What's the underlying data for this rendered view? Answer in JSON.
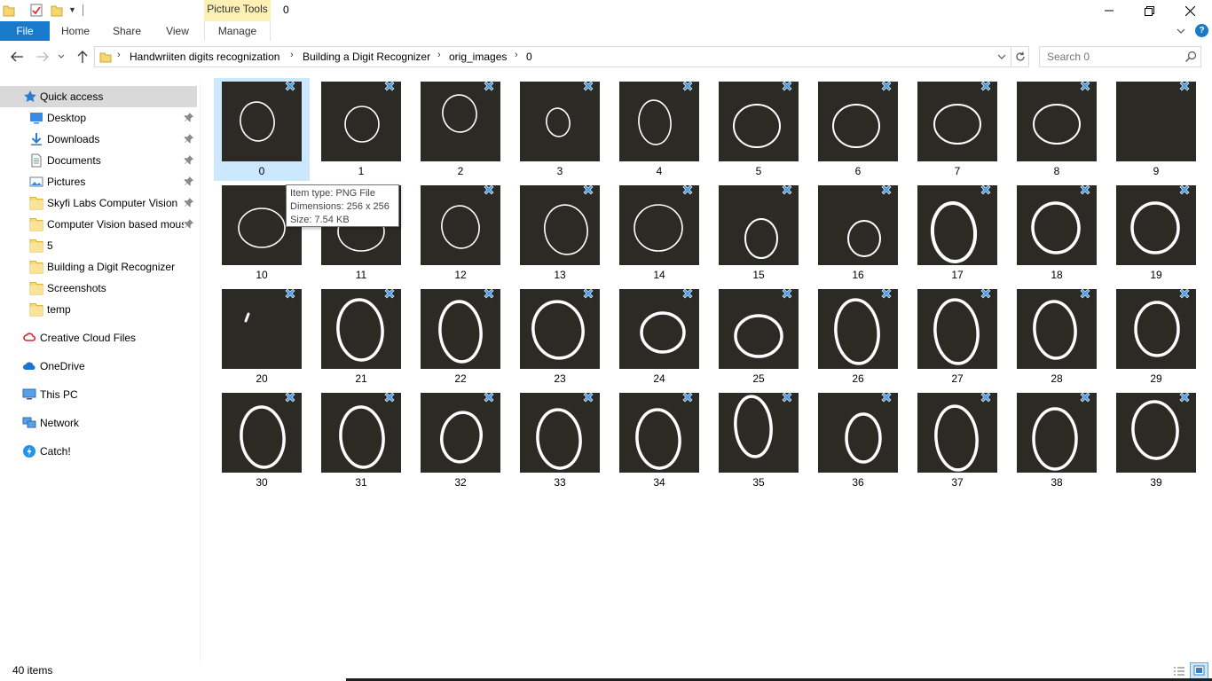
{
  "titlebar": {
    "context_tab": "Picture Tools",
    "title": "0"
  },
  "ribbon": {
    "tabs": [
      "File",
      "Home",
      "Share",
      "View",
      "Manage"
    ]
  },
  "address": {
    "breadcrumbs": [
      "Handwriiten digits recognization",
      "Building a Digit Recognizer",
      "orig_images",
      "0"
    ]
  },
  "search": {
    "placeholder": "Search 0"
  },
  "nav": {
    "items": [
      {
        "label": "Quick access",
        "icon": "star-icon"
      },
      {
        "label": "Desktop",
        "icon": "desktop-icon",
        "pinned": true
      },
      {
        "label": "Downloads",
        "icon": "download-icon",
        "pinned": true
      },
      {
        "label": "Documents",
        "icon": "documents-icon",
        "pinned": true
      },
      {
        "label": "Pictures",
        "icon": "pictures-icon",
        "pinned": true
      },
      {
        "label": "Skyfi Labs Computer Vision",
        "icon": "folder-icon",
        "pinned": true
      },
      {
        "label": "Computer Vision based mous",
        "icon": "folder-icon",
        "pinned": true
      },
      {
        "label": "5",
        "icon": "folder-icon"
      },
      {
        "label": "Building a Digit Recognizer",
        "icon": "folder-icon"
      },
      {
        "label": "Screenshots",
        "icon": "folder-icon"
      },
      {
        "label": "temp",
        "icon": "folder-icon"
      },
      {
        "label": "Creative Cloud Files",
        "icon": "creative-cloud-icon"
      },
      {
        "label": "OneDrive",
        "icon": "onedrive-icon"
      },
      {
        "label": "This PC",
        "icon": "this-pc-icon"
      },
      {
        "label": "Network",
        "icon": "network-icon"
      },
      {
        "label": "Catch!",
        "icon": "catch-icon"
      }
    ]
  },
  "files": [
    {
      "name": "0"
    },
    {
      "name": "1"
    },
    {
      "name": "2"
    },
    {
      "name": "3"
    },
    {
      "name": "4"
    },
    {
      "name": "5"
    },
    {
      "name": "6"
    },
    {
      "name": "7"
    },
    {
      "name": "8"
    },
    {
      "name": "9"
    },
    {
      "name": "10"
    },
    {
      "name": "11"
    },
    {
      "name": "12"
    },
    {
      "name": "13"
    },
    {
      "name": "14"
    },
    {
      "name": "15"
    },
    {
      "name": "16"
    },
    {
      "name": "17"
    },
    {
      "name": "18"
    },
    {
      "name": "19"
    },
    {
      "name": "20"
    },
    {
      "name": "21"
    },
    {
      "name": "22"
    },
    {
      "name": "23"
    },
    {
      "name": "24"
    },
    {
      "name": "25"
    },
    {
      "name": "26"
    },
    {
      "name": "27"
    },
    {
      "name": "28"
    },
    {
      "name": "29"
    },
    {
      "name": "30"
    },
    {
      "name": "31"
    },
    {
      "name": "32"
    },
    {
      "name": "33"
    },
    {
      "name": "34"
    },
    {
      "name": "35"
    },
    {
      "name": "36"
    },
    {
      "name": "37"
    },
    {
      "name": "38"
    },
    {
      "name": "39"
    }
  ],
  "selected_file": "0",
  "tooltip": {
    "type_line": "Item type: PNG File",
    "dimensions_line": "Dimensions: 256 x 256",
    "size_line": "Size: 7.54 KB"
  },
  "status": {
    "item_count": "40 items"
  },
  "colors": {
    "accent": "#1979ca",
    "selection": "#cce8ff",
    "context_tab": "#fdf0b4",
    "thumbnail_bg": "#2b2a25"
  }
}
